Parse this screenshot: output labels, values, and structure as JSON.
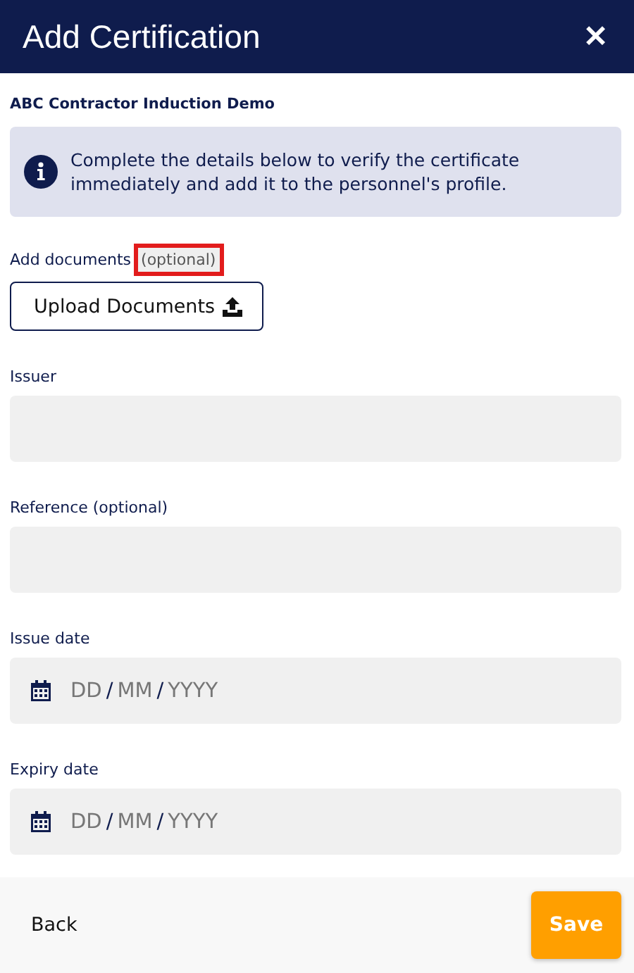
{
  "header": {
    "title": "Add Certification",
    "close": "✕"
  },
  "organisation": "ABC Contractor Induction Demo",
  "notice": "Complete the details below to verify the certificate immediately and add it to the personnel's profile.",
  "documents": {
    "label": "Add documents",
    "note": "(optional)",
    "highlighted": true,
    "button": "Upload Documents"
  },
  "fields": [
    {
      "kind": "text",
      "label": "Issuer"
    },
    {
      "kind": "text",
      "label": "Reference (optional)"
    },
    {
      "kind": "date",
      "label": "Issue date",
      "parts": [
        "DD",
        "MM",
        "YYYY"
      ],
      "separator": "/"
    },
    {
      "kind": "date",
      "label": "Expiry date",
      "parts": [
        "DD",
        "MM",
        "YYYY"
      ],
      "separator": "/"
    }
  ],
  "footer": {
    "back": "Back",
    "save": "Save"
  }
}
